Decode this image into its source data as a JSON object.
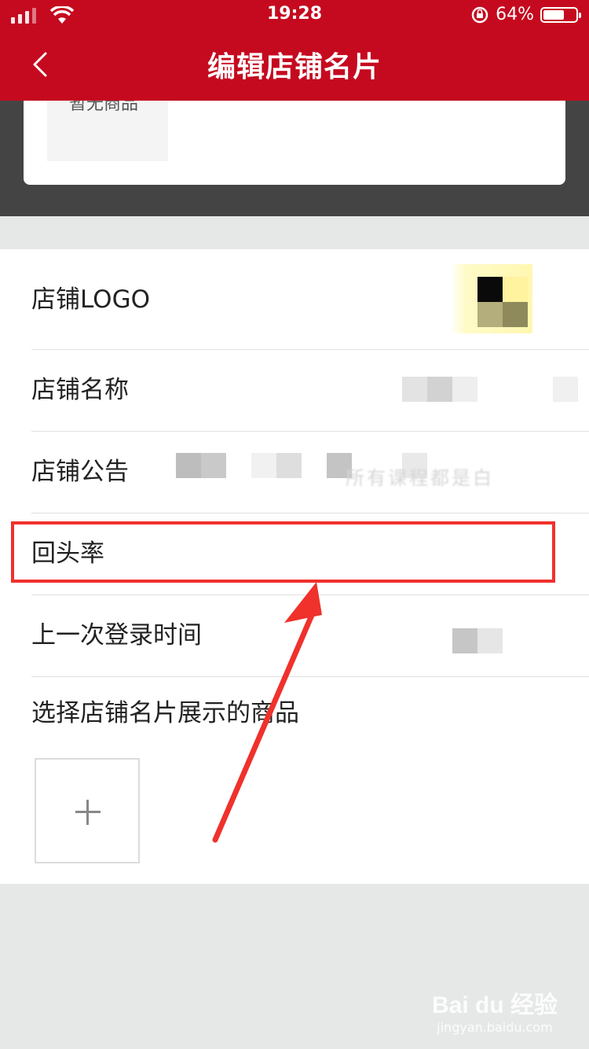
{
  "status_bar": {
    "time": "19:28",
    "battery": "64%",
    "battery_level": 0.64
  },
  "nav": {
    "title": "编辑店铺名片",
    "back_icon": "chevron-left-icon"
  },
  "preview": {
    "thumb_text": "暂无商品"
  },
  "rows": {
    "logo": "店铺LOGO",
    "name": "店铺名称",
    "notice": "店铺公告",
    "notice_blur_tail": "所有课程都是白",
    "return_rate": "回头率",
    "last_login": "上一次登录时间",
    "select_goods": "选择店铺名片展示的商品"
  },
  "add_icon": "plus-icon",
  "watermark": {
    "main": "Bai du 经验",
    "sub": "jingyan.baidu.com"
  },
  "colors": {
    "brand_red": "#c50a1f",
    "annotation_red": "#f0312c"
  }
}
